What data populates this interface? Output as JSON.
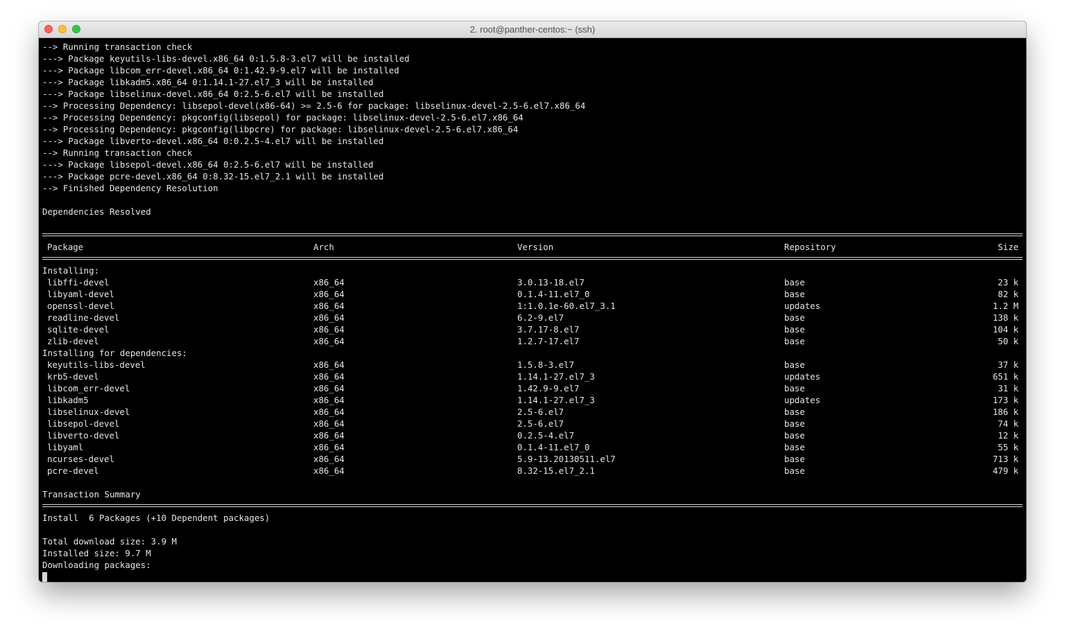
{
  "window": {
    "title": "2. root@panther-centos:~ (ssh)"
  },
  "log_lines": [
    "--> Running transaction check",
    "---> Package keyutils-libs-devel.x86_64 0:1.5.8-3.el7 will be installed",
    "---> Package libcom_err-devel.x86_64 0:1.42.9-9.el7 will be installed",
    "---> Package libkadm5.x86_64 0:1.14.1-27.el7_3 will be installed",
    "---> Package libselinux-devel.x86_64 0:2.5-6.el7 will be installed",
    "--> Processing Dependency: libsepol-devel(x86-64) >= 2.5-6 for package: libselinux-devel-2.5-6.el7.x86_64",
    "--> Processing Dependency: pkgconfig(libsepol) for package: libselinux-devel-2.5-6.el7.x86_64",
    "--> Processing Dependency: pkgconfig(libpcre) for package: libselinux-devel-2.5-6.el7.x86_64",
    "---> Package libverto-devel.x86_64 0:0.2.5-4.el7 will be installed",
    "--> Running transaction check",
    "---> Package libsepol-devel.x86_64 0:2.5-6.el7 will be installed",
    "---> Package pcre-devel.x86_64 0:8.32-15.el7_2.1 will be installed",
    "--> Finished Dependency Resolution",
    "",
    "Dependencies Resolved"
  ],
  "table": {
    "headers": {
      "package": "Package",
      "arch": "Arch",
      "version": "Version",
      "repository": "Repository",
      "size": "Size"
    },
    "installing_label": "Installing:",
    "installing": [
      {
        "name": "libffi-devel",
        "arch": "x86_64",
        "version": "3.0.13-18.el7",
        "repo": "base",
        "size": "23 k"
      },
      {
        "name": "libyaml-devel",
        "arch": "x86_64",
        "version": "0.1.4-11.el7_0",
        "repo": "base",
        "size": "82 k"
      },
      {
        "name": "openssl-devel",
        "arch": "x86_64",
        "version": "1:1.0.1e-60.el7_3.1",
        "repo": "updates",
        "size": "1.2 M"
      },
      {
        "name": "readline-devel",
        "arch": "x86_64",
        "version": "6.2-9.el7",
        "repo": "base",
        "size": "138 k"
      },
      {
        "name": "sqlite-devel",
        "arch": "x86_64",
        "version": "3.7.17-8.el7",
        "repo": "base",
        "size": "104 k"
      },
      {
        "name": "zlib-devel",
        "arch": "x86_64",
        "version": "1.2.7-17.el7",
        "repo": "base",
        "size": "50 k"
      }
    ],
    "deps_label": "Installing for dependencies:",
    "dependencies": [
      {
        "name": "keyutils-libs-devel",
        "arch": "x86_64",
        "version": "1.5.8-3.el7",
        "repo": "base",
        "size": "37 k"
      },
      {
        "name": "krb5-devel",
        "arch": "x86_64",
        "version": "1.14.1-27.el7_3",
        "repo": "updates",
        "size": "651 k"
      },
      {
        "name": "libcom_err-devel",
        "arch": "x86_64",
        "version": "1.42.9-9.el7",
        "repo": "base",
        "size": "31 k"
      },
      {
        "name": "libkadm5",
        "arch": "x86_64",
        "version": "1.14.1-27.el7_3",
        "repo": "updates",
        "size": "173 k"
      },
      {
        "name": "libselinux-devel",
        "arch": "x86_64",
        "version": "2.5-6.el7",
        "repo": "base",
        "size": "186 k"
      },
      {
        "name": "libsepol-devel",
        "arch": "x86_64",
        "version": "2.5-6.el7",
        "repo": "base",
        "size": "74 k"
      },
      {
        "name": "libverto-devel",
        "arch": "x86_64",
        "version": "0.2.5-4.el7",
        "repo": "base",
        "size": "12 k"
      },
      {
        "name": "libyaml",
        "arch": "x86_64",
        "version": "0.1.4-11.el7_0",
        "repo": "base",
        "size": "55 k"
      },
      {
        "name": "ncurses-devel",
        "arch": "x86_64",
        "version": "5.9-13.20130511.el7",
        "repo": "base",
        "size": "713 k"
      },
      {
        "name": "pcre-devel",
        "arch": "x86_64",
        "version": "8.32-15.el7_2.1",
        "repo": "base",
        "size": "479 k"
      }
    ]
  },
  "summary": {
    "title": "Transaction Summary",
    "install_line": "Install  6 Packages (+10 Dependent packages)",
    "total_download": "Total download size: 3.9 M",
    "installed_size": "Installed size: 9.7 M",
    "downloading": "Downloading packages:"
  }
}
